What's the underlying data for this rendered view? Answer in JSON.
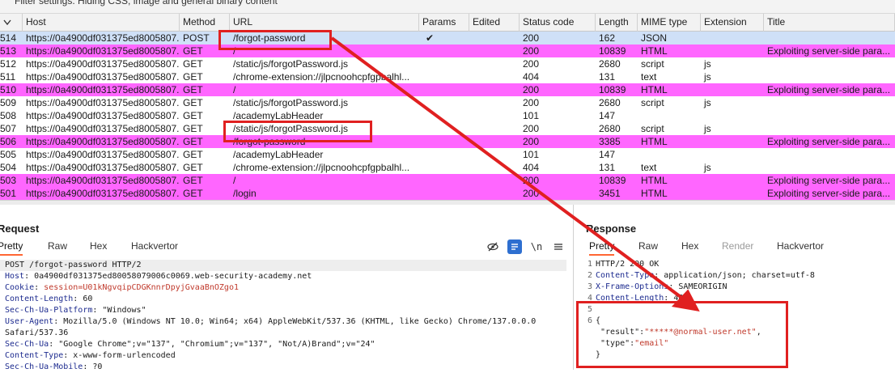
{
  "filter_bar": {
    "text": "Filter settings: Hiding CSS, image and general binary content"
  },
  "columns": [
    "Host",
    "Method",
    "URL",
    "Params",
    "Edited",
    "Status code",
    "Length",
    "MIME type",
    "Extension",
    "Title"
  ],
  "rows": [
    {
      "id": "514",
      "host": "https://0a4900df031375ed8005807...",
      "method": "POST",
      "url": "/forgot-password",
      "params": "✔",
      "status": "200",
      "length": "162",
      "mime": "JSON",
      "ext": "",
      "title": "",
      "style": "sel"
    },
    {
      "id": "513",
      "host": "https://0a4900df031375ed8005807...",
      "method": "GET",
      "url": "/",
      "params": "",
      "status": "200",
      "length": "10839",
      "mime": "HTML",
      "ext": "",
      "title": "Exploiting server-side para...",
      "style": "hl"
    },
    {
      "id": "512",
      "host": "https://0a4900df031375ed8005807...",
      "method": "GET",
      "url": "/static/js/forgotPassword.js",
      "params": "",
      "status": "200",
      "length": "2680",
      "mime": "script",
      "ext": "js",
      "title": "",
      "style": ""
    },
    {
      "id": "511",
      "host": "https://0a4900df031375ed8005807...",
      "method": "GET",
      "url": "/chrome-extension://jlpcnoohcpfgpbalhl...",
      "params": "",
      "status": "404",
      "length": "131",
      "mime": "text",
      "ext": "js",
      "title": "",
      "style": ""
    },
    {
      "id": "510",
      "host": "https://0a4900df031375ed8005807...",
      "method": "GET",
      "url": "/",
      "params": "",
      "status": "200",
      "length": "10839",
      "mime": "HTML",
      "ext": "",
      "title": "Exploiting server-side para...",
      "style": "hl"
    },
    {
      "id": "509",
      "host": "https://0a4900df031375ed8005807...",
      "method": "GET",
      "url": "/static/js/forgotPassword.js",
      "params": "",
      "status": "200",
      "length": "2680",
      "mime": "script",
      "ext": "js",
      "title": "",
      "style": ""
    },
    {
      "id": "508",
      "host": "https://0a4900df031375ed8005807...",
      "method": "GET",
      "url": "/academyLabHeader",
      "params": "",
      "status": "101",
      "length": "147",
      "mime": "",
      "ext": "",
      "title": "",
      "style": ""
    },
    {
      "id": "507",
      "host": "https://0a4900df031375ed8005807...",
      "method": "GET",
      "url": "/static/js/forgotPassword.js",
      "params": "",
      "status": "200",
      "length": "2680",
      "mime": "script",
      "ext": "js",
      "title": "",
      "style": ""
    },
    {
      "id": "506",
      "host": "https://0a4900df031375ed8005807...",
      "method": "GET",
      "url": "/forgot-password",
      "params": "",
      "status": "200",
      "length": "3385",
      "mime": "HTML",
      "ext": "",
      "title": "Exploiting server-side para...",
      "style": "hl"
    },
    {
      "id": "505",
      "host": "https://0a4900df031375ed8005807...",
      "method": "GET",
      "url": "/academyLabHeader",
      "params": "",
      "status": "101",
      "length": "147",
      "mime": "",
      "ext": "",
      "title": "",
      "style": ""
    },
    {
      "id": "504",
      "host": "https://0a4900df031375ed8005807...",
      "method": "GET",
      "url": "/chrome-extension://jlpcnoohcpfgpbalhl...",
      "params": "",
      "status": "404",
      "length": "131",
      "mime": "text",
      "ext": "js",
      "title": "",
      "style": ""
    },
    {
      "id": "503",
      "host": "https://0a4900df031375ed8005807...",
      "method": "GET",
      "url": "/",
      "params": "",
      "status": "200",
      "length": "10839",
      "mime": "HTML",
      "ext": "",
      "title": "Exploiting server-side para...",
      "style": "hl"
    },
    {
      "id": "501",
      "host": "https://0a4900df031375ed8005807...",
      "method": "GET",
      "url": "/login",
      "params": "",
      "status": "200",
      "length": "3451",
      "mime": "HTML",
      "ext": "",
      "title": "Exploiting server-side para...",
      "style": "hl"
    }
  ],
  "request": {
    "title": "Request",
    "tabs": [
      "Pretty",
      "Raw",
      "Hex",
      "Hackvertor"
    ],
    "newline_label": "\\n",
    "lines": [
      {
        "k": "",
        "v": "POST /forgot-password HTTP/2"
      },
      {
        "k": "Host",
        "v": ": 0a4900df031375ed80058079006c0069.web-security-academy.net"
      },
      {
        "k": "Cookie",
        "v": ": ",
        "s": "session=U01kNgvqipCDGKnnrDpyjGvaaBnOZgo1"
      },
      {
        "k": "Content-Length",
        "v": ": 60"
      },
      {
        "k": "Sec-Ch-Ua-Platform",
        "v": ": \"Windows\""
      },
      {
        "k": "User-Agent",
        "v": ": Mozilla/5.0 (Windows NT 10.0; Win64; x64) AppleWebKit/537.36 (KHTML, like Gecko) Chrome/137.0.0.0"
      },
      {
        "k": "",
        "v": "Safari/537.36"
      },
      {
        "k": "Sec-Ch-Ua",
        "v": ": \"Google Chrome\";v=\"137\", \"Chromium\";v=\"137\", \"Not/A)Brand\";v=\"24\""
      },
      {
        "k": "Content-Type",
        "v": ": x-www-form-urlencoded"
      },
      {
        "k": "Sec-Ch-Ua-Mobile",
        "v": ": ?0"
      }
    ]
  },
  "response": {
    "title": "Response",
    "tabs": [
      "Pretty",
      "Raw",
      "Hex",
      "Render",
      "Hackvertor"
    ],
    "lines": [
      {
        "n": "1",
        "k": "",
        "v": "HTTP/2 200 OK"
      },
      {
        "n": "2",
        "k": "Content-Type",
        "v": ": application/json; charset=utf-8"
      },
      {
        "n": "3",
        "k": "X-Frame-Options",
        "v": ": SAMEORIGIN"
      },
      {
        "n": "4",
        "k": "Content-Length",
        "v": ": 48"
      },
      {
        "n": "5",
        "k": "",
        "v": ""
      },
      {
        "n": "6",
        "k": "",
        "v": "{"
      },
      {
        "n": "",
        "k": "",
        "v": "  \"result\":",
        "s": "\"*****@normal-user.net\"",
        "t": ","
      },
      {
        "n": "",
        "k": "",
        "v": "  \"type\":",
        "s": "\"email\""
      },
      {
        "n": "",
        "k": "",
        "v": "}"
      }
    ]
  },
  "colors": {
    "highlight": "#ff66ff",
    "selected": "#cfe0f7",
    "annotation": "#e02020",
    "tab_underline": "#ff6633"
  }
}
